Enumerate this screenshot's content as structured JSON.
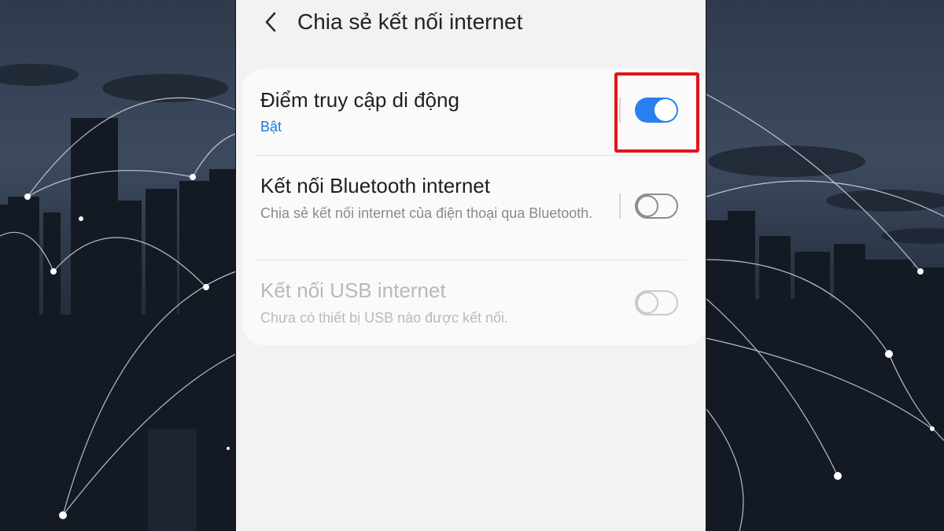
{
  "header": {
    "title": "Chia sẻ kết nối internet"
  },
  "settings": {
    "items": [
      {
        "title": "Điểm truy cập di động",
        "subtitle": "Bật",
        "toggle_state": "on"
      },
      {
        "title": "Kết nối Bluetooth internet",
        "subtitle": "Chia sẻ kết nối internet của điện thoại qua Bluetooth.",
        "toggle_state": "off"
      },
      {
        "title": "Kết nối USB internet",
        "subtitle": "Chưa có thiết bị USB nào được kết nối.",
        "toggle_state": "off-disabled"
      }
    ]
  },
  "colors": {
    "accent": "#2a7ff0",
    "highlight": "#e0151b",
    "subtitle_on": "#1a7ad8"
  }
}
